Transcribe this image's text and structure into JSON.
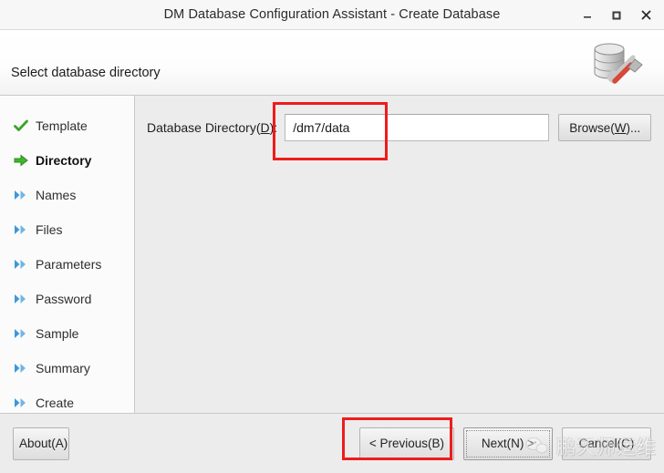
{
  "window": {
    "title": "DM Database Configuration Assistant - Create Database",
    "controls": {
      "minimize": "minimize-icon",
      "maximize": "maximize-icon",
      "close": "close-icon"
    }
  },
  "header": {
    "title": "Select database directory",
    "icon": "database-tools-icon"
  },
  "sidebar": {
    "items": [
      {
        "label": "Template",
        "state": "done",
        "icon": "check-icon"
      },
      {
        "label": "Directory",
        "state": "current",
        "icon": "arrow-right-icon"
      },
      {
        "label": "Names",
        "state": "pending",
        "icon": "double-chevron-icon"
      },
      {
        "label": "Files",
        "state": "pending",
        "icon": "double-chevron-icon"
      },
      {
        "label": "Parameters",
        "state": "pending",
        "icon": "double-chevron-icon"
      },
      {
        "label": "Password",
        "state": "pending",
        "icon": "double-chevron-icon"
      },
      {
        "label": "Sample",
        "state": "pending",
        "icon": "double-chevron-icon"
      },
      {
        "label": "Summary",
        "state": "pending",
        "icon": "double-chevron-icon"
      },
      {
        "label": "Create",
        "state": "pending",
        "icon": "double-chevron-icon"
      }
    ]
  },
  "form": {
    "directory_label_pre": "Database Directory(",
    "directory_label_key": "D",
    "directory_label_post": "):",
    "directory_value": "/dm7/data",
    "browse_pre": "Browse(",
    "browse_key": "W",
    "browse_post": ")..."
  },
  "footer": {
    "about": "About(A)",
    "previous": "< Previous(B)",
    "next": "Next(N) >",
    "cancel": "Cancel(C)"
  },
  "watermark": {
    "text": "鹏天师运维",
    "icon": "chat-bubble-icon"
  },
  "annotations": {
    "accent_color": "#ee1c1c",
    "targets": [
      "database-directory-input",
      "next-button"
    ]
  }
}
